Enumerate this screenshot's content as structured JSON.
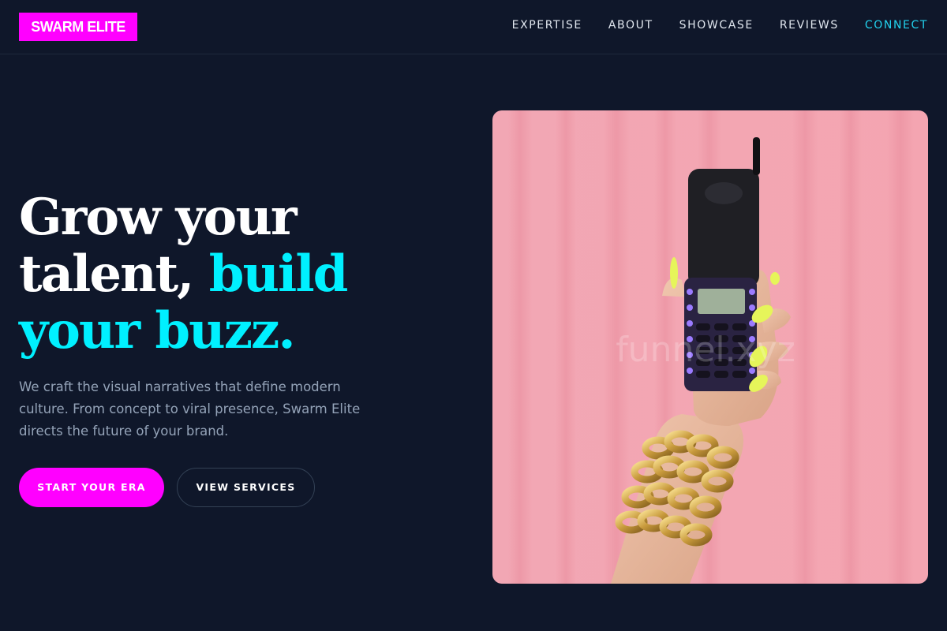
{
  "brand": {
    "logo_text": "SWARM ELITE"
  },
  "nav": {
    "items": [
      {
        "label": "EXPERTISE"
      },
      {
        "label": "ABOUT"
      },
      {
        "label": "SHOWCASE"
      },
      {
        "label": "REVIEWS"
      },
      {
        "label": "CONNECT"
      }
    ]
  },
  "hero": {
    "title_line1": "Grow your",
    "title_line2a": "talent, ",
    "title_line2b": "build",
    "title_line3": "your buzz.",
    "description": "We craft the visual narratives that define modern culture. From concept to viral presence, Swarm Elite directs the future of your brand.",
    "primary_cta": "START YOUR ERA",
    "secondary_cta": "VIEW SERVICES",
    "image_watermark": "funnel.xyz"
  },
  "colors": {
    "background": "#0f172a",
    "brand_magenta": "#ff00ff",
    "accent_cyan": "#00f0ff",
    "nav_accent": "#22d3ee",
    "muted_text": "#94a3b8"
  }
}
